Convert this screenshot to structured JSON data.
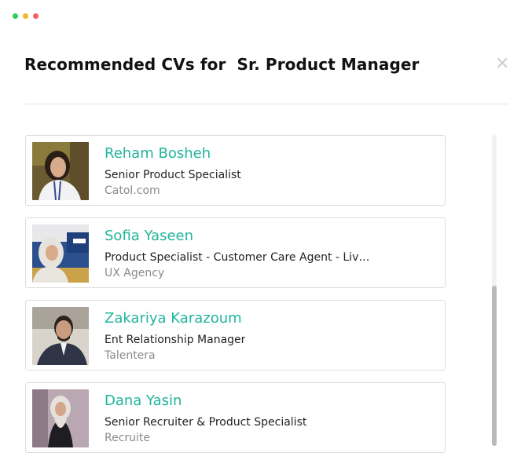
{
  "window": {
    "controls": [
      "green",
      "yellow",
      "red"
    ]
  },
  "modal": {
    "title": "Recommended CVs for  Sr. Product Manager",
    "close_icon": "close-icon"
  },
  "candidates": [
    {
      "name": "Reham Bosheh",
      "job_title": "Senior Product Specialist",
      "company": "Catol.com"
    },
    {
      "name": "Sofia Yaseen",
      "job_title": "Product Specialist - Customer Care Agent - Live Chat",
      "company": "UX Agency"
    },
    {
      "name": "Zakariya Karazoum",
      "job_title": "Ent Relationship Manager",
      "company": "Talentera"
    },
    {
      "name": "Dana Yasin",
      "job_title": "Senior Recruiter & Product Specialist",
      "company": "Recruite"
    }
  ],
  "colors": {
    "name": "#21b59b",
    "title": "#111111",
    "company": "#8a8a8a"
  }
}
